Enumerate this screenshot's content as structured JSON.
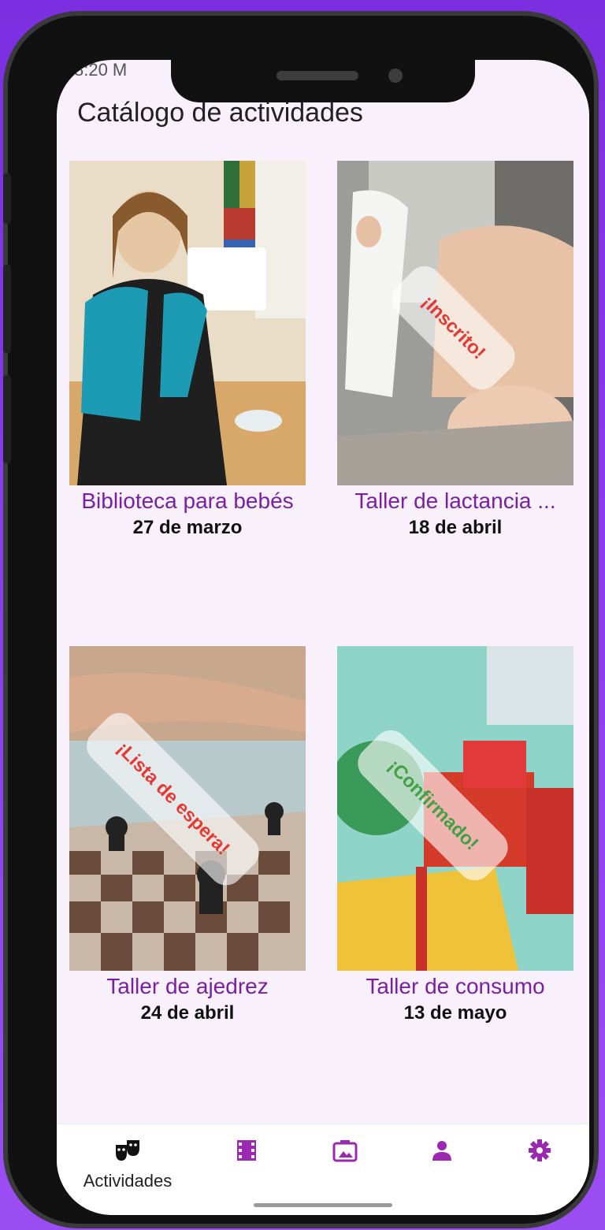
{
  "status_bar": {
    "left_text": "8:20 M"
  },
  "page": {
    "title": "Catálogo de actividades"
  },
  "activities": [
    {
      "title": "Biblioteca para bebés",
      "date": "27 de marzo",
      "badge": ""
    },
    {
      "title": "Taller de lactancia ...",
      "date": "18 de abril",
      "badge": "¡Inscrito!",
      "badge_color": "#e53935"
    },
    {
      "title": "Taller de ajedrez",
      "date": "24 de abril",
      "badge": "¡Lista de espera!",
      "badge_color": "#e53935"
    },
    {
      "title": "Taller de consumo",
      "date": "13 de mayo",
      "badge": "¡Confirmado!",
      "badge_color": "#43a047"
    }
  ],
  "nav": {
    "items": [
      {
        "icon": "theater-masks-icon",
        "label": "Actividades",
        "active": true
      },
      {
        "icon": "film-icon",
        "label": ""
      },
      {
        "icon": "gallery-icon",
        "label": ""
      },
      {
        "icon": "person-icon",
        "label": ""
      },
      {
        "icon": "gear-icon",
        "label": ""
      }
    ]
  },
  "colors": {
    "accent": "#7b1fa2",
    "background": "#f8f1fc",
    "outer": "#8a3cf0"
  }
}
